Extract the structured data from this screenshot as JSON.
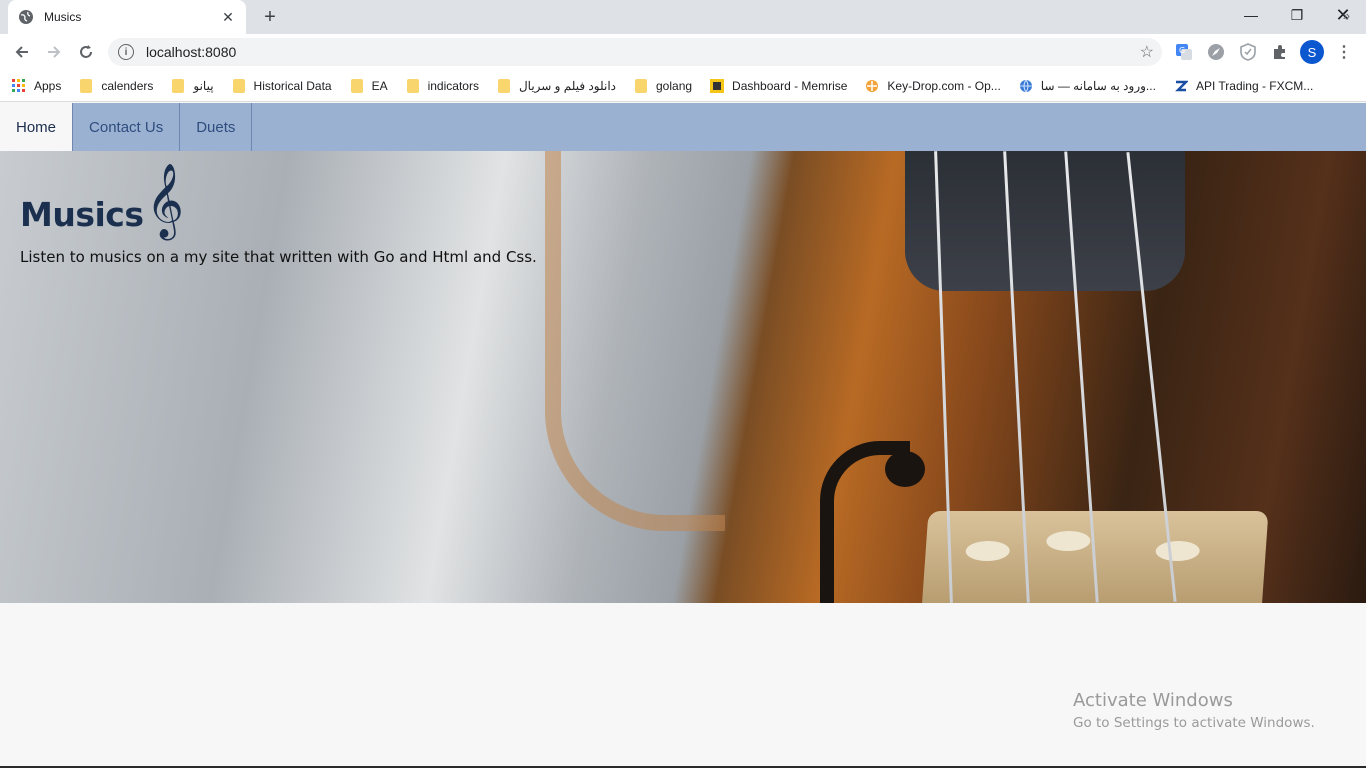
{
  "browser": {
    "tab_title": "Musics",
    "tab_close": "✕",
    "new_tab": "+",
    "url": "localhost:8080",
    "window_controls": {
      "minimize": "—",
      "restore": "❐",
      "close": "✕"
    },
    "profile_initial": "S",
    "bookmarks": [
      {
        "label": "Apps",
        "icon": "apps-grid-icon"
      },
      {
        "label": "calenders",
        "icon": "folder-icon"
      },
      {
        "label": "پیانو",
        "icon": "folder-icon"
      },
      {
        "label": "Historical Data",
        "icon": "folder-icon"
      },
      {
        "label": "EA",
        "icon": "folder-icon"
      },
      {
        "label": "indicators",
        "icon": "folder-icon"
      },
      {
        "label": "دانلود فیلم و سریال",
        "icon": "folder-icon"
      },
      {
        "label": "golang",
        "icon": "folder-icon"
      },
      {
        "label": "Dashboard - Memrise",
        "icon": "memrise-icon"
      },
      {
        "label": "Key-Drop.com - Op...",
        "icon": "keydrop-icon"
      },
      {
        "label": "ورود به سامانه — سا...",
        "icon": "globe-icon"
      },
      {
        "label": "API Trading - FXCM...",
        "icon": "fxcm-icon"
      }
    ],
    "bookmarks_more": "»"
  },
  "site": {
    "nav": [
      {
        "label": "Home",
        "active": true
      },
      {
        "label": "Contact Us",
        "active": false
      },
      {
        "label": "Duets",
        "active": false
      }
    ],
    "hero": {
      "title": "Musics",
      "clef": "𝄞",
      "subtitle": "Listen to musics on a my site that written with Go and Html and Css."
    }
  },
  "os": {
    "watermark_line1": "Activate Windows",
    "watermark_line2": "Go to Settings to activate Windows."
  },
  "colors": {
    "nav_bg": "#9bb1d2",
    "nav_text": "#2e4d7e",
    "title_color": "#1b2f4f",
    "profile_bg": "#0b57d0"
  }
}
